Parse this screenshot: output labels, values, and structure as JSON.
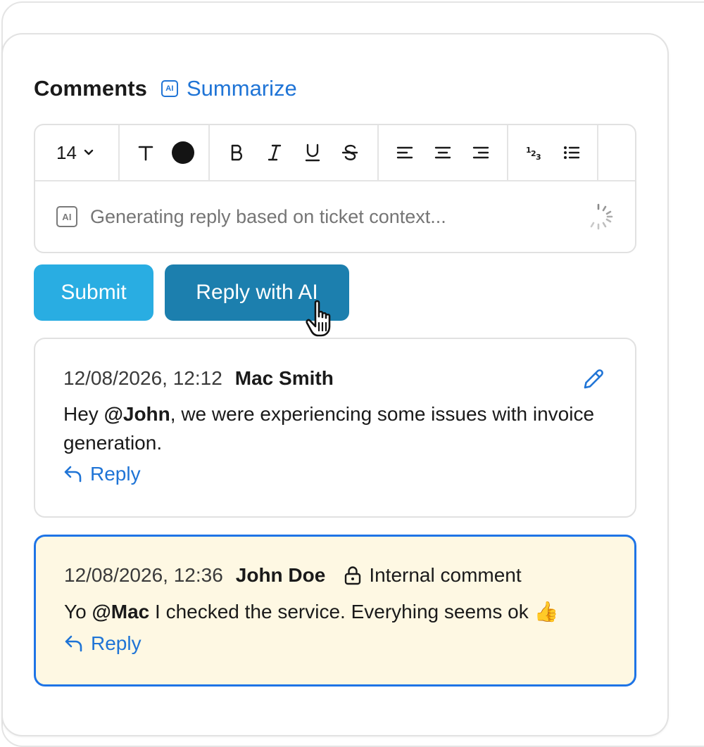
{
  "header": {
    "title": "Comments",
    "summarize_label": "Summarize",
    "ai_badge": "AI"
  },
  "toolbar": {
    "font_size": "14",
    "text_color": "#141414",
    "tools": [
      "font-size",
      "text-style",
      "text-color",
      "bold",
      "italic",
      "underline",
      "strikethrough",
      "align-left",
      "align-center",
      "align-right",
      "numbered-list",
      "bulleted-list"
    ]
  },
  "composer": {
    "ai_badge": "AI",
    "placeholder": "Generating reply based on ticket context..."
  },
  "actions": {
    "submit_label": "Submit",
    "reply_ai_label": "Reply with AI"
  },
  "comments": [
    {
      "timestamp": "12/08/2026, 12:12",
      "author": "Mac Smith",
      "body_pre": "Hey ",
      "mention": "@John",
      "body_post": ", we were experiencing some issues with invoice generation.",
      "reply_label": "Reply"
    },
    {
      "timestamp": "12/08/2026, 12:36",
      "author": "John Doe",
      "internal_label": "Internal comment",
      "body_pre": "Yo ",
      "mention": "@Mac",
      "body_post": " I checked the service. Everyhing seems ok 👍",
      "reply_label": "Reply"
    }
  ],
  "colors": {
    "accent_blue": "#1f74d6",
    "submit_bg": "#29ade2",
    "reply_ai_bg": "#1c7fae",
    "internal_bg": "#fef8e3",
    "internal_border": "#1e74e6"
  }
}
